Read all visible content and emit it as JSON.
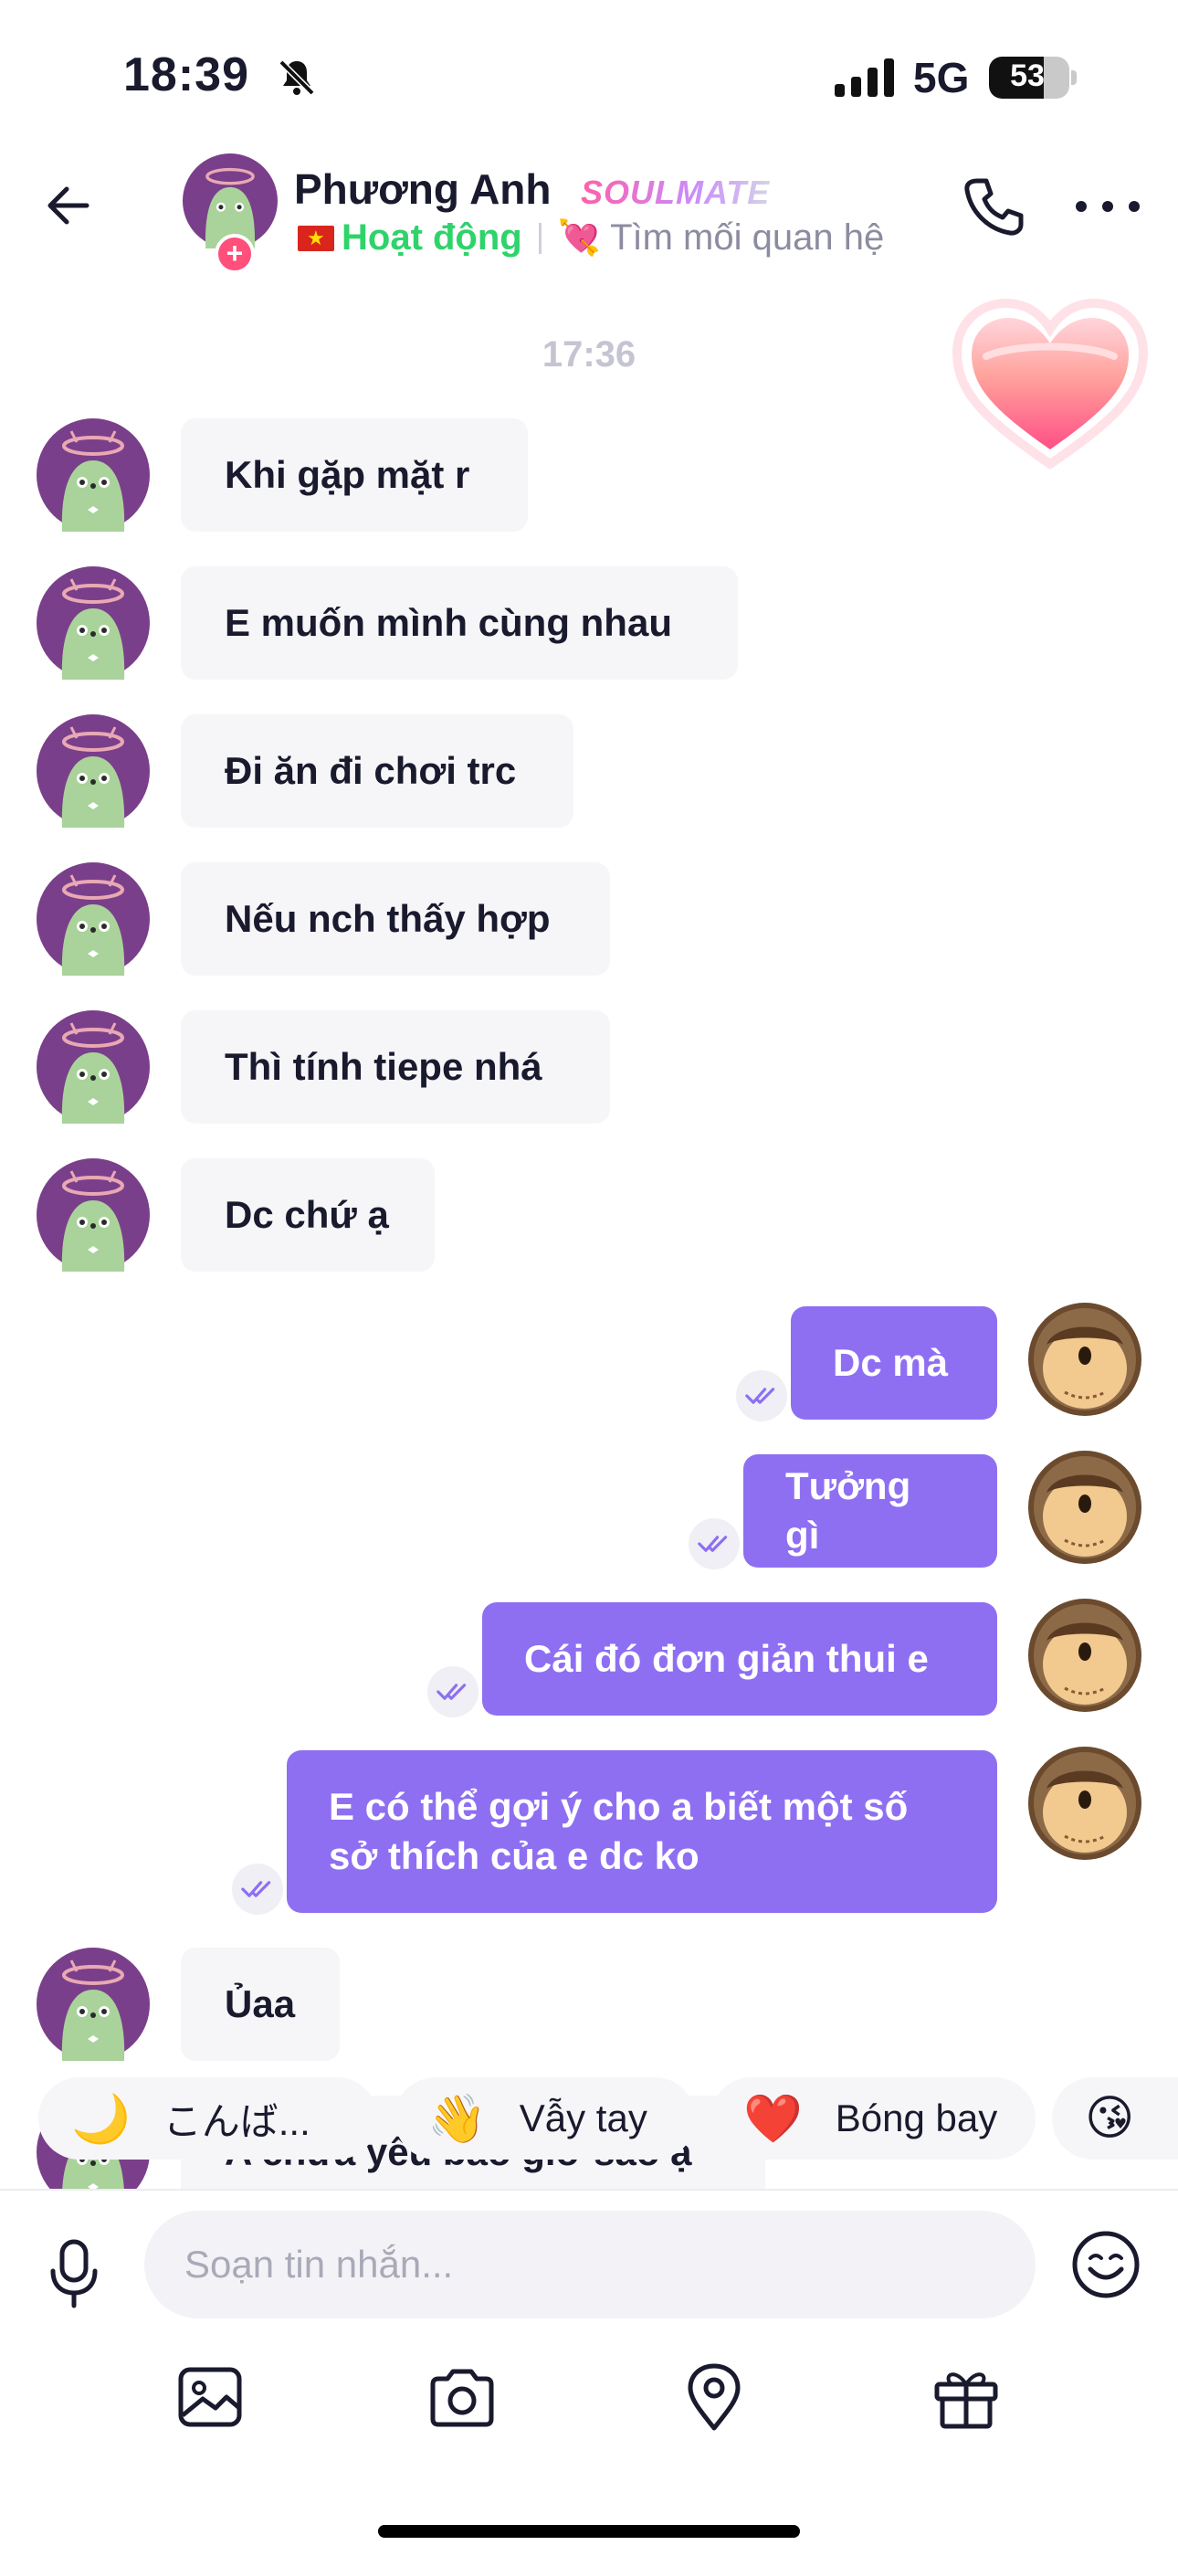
{
  "status_bar": {
    "time": "18:39",
    "network": "5G",
    "battery": "53",
    "icons": [
      "bell-muted-icon",
      "signal-icon",
      "battery-icon"
    ]
  },
  "header": {
    "contact_name": "Phương Anh",
    "badge": "SOULMATE",
    "online_status": "Hoạt động",
    "relationship": "Tìm mối quan hệ",
    "icons": [
      "back-arrow-icon",
      "phone-icon",
      "more-icon",
      "vietnam-flag-icon",
      "heart-arrow-icon"
    ]
  },
  "chat": {
    "timestamp": "17:36",
    "messages": [
      {
        "from": "them",
        "text": "Khi gặp mặt r"
      },
      {
        "from": "them",
        "text": "E muốn mình cùng nhau"
      },
      {
        "from": "them",
        "text": "Đi ăn đi chơi trc"
      },
      {
        "from": "them",
        "text": "Nếu nch thấy hợp"
      },
      {
        "from": "them",
        "text": "Thì tính tiepe nhá"
      },
      {
        "from": "them",
        "text": "Dc chứ ạ"
      },
      {
        "from": "me",
        "text": "Dc mà",
        "read": true
      },
      {
        "from": "me",
        "text": "Tưởng gì",
        "read": true
      },
      {
        "from": "me",
        "text": "Cái đó đơn giản thui e",
        "read": true
      },
      {
        "from": "me",
        "text": "E có thể gợi ý cho a biết một số\nsở thích của e dc ko",
        "read": true
      },
      {
        "from": "them",
        "text": "Ủaa"
      },
      {
        "from": "them",
        "text": "A chưa yêu bao giờ sao ạ"
      }
    ]
  },
  "quick_replies": [
    {
      "icon": "🌙",
      "label": "こんば..."
    },
    {
      "icon": "👋",
      "label": "Vẫy tay"
    },
    {
      "icon": "❤️",
      "label": "Bóng bay"
    },
    {
      "icon": "😘",
      "label": ""
    }
  ],
  "composer": {
    "placeholder": "Soạn tin nhắn...",
    "tools": [
      "image-icon",
      "camera-icon",
      "location-icon",
      "gift-icon"
    ]
  },
  "colors": {
    "accent": "#8e6ff2",
    "incoming_bubble": "#f6f6f9",
    "online": "#2ed36a",
    "soulmate": "#ff5fa8"
  }
}
